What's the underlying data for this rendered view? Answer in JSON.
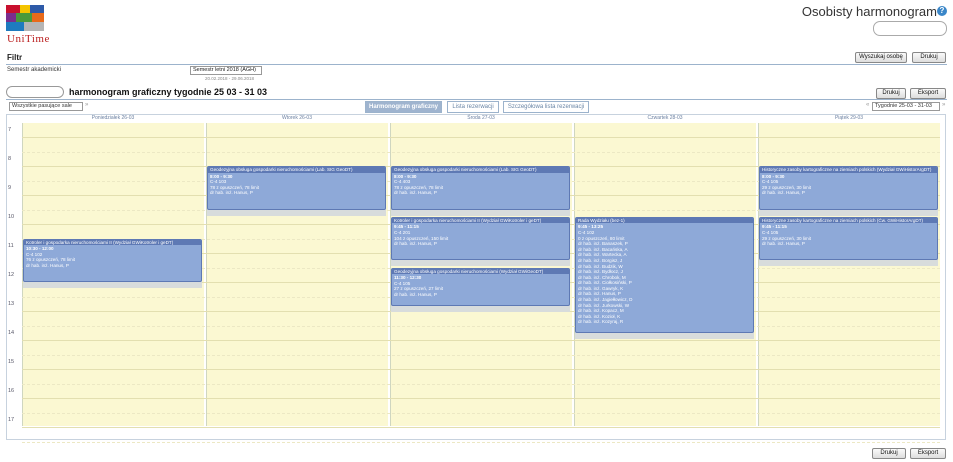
{
  "app": {
    "logo_text": "UniTime",
    "page_title": "Osobisty harmonogram",
    "help_icon": "help-icon"
  },
  "filter": {
    "label": "Filtr",
    "search_person_button": "Wyszukaj osobę",
    "print_button": "Drukuj",
    "term_label": "Semestr akademicki",
    "term_value": "Semestr letni 2018 (AGH)",
    "term_dates": "20.02.2018 - 29.06.2018"
  },
  "schedule": {
    "title": "harmonogram graficzny tygodnie 25 03 - 31 03",
    "print_button": "Drukuj",
    "export_button": "Eksport",
    "rooms_filter": "Wszystkie pasujące sale",
    "week_select": "Tygodnie 25-03 - 31-03",
    "tabs": [
      {
        "label": "Harmonogram graficzny",
        "active": true
      },
      {
        "label": "Lista rezerwacji",
        "active": false
      },
      {
        "label": "Szczegółowa lista rezerwacji",
        "active": false
      }
    ],
    "days": [
      "Poniedziałek 26-03",
      "Wtorek 26-03",
      "Środa 27-03",
      "Czwartek 28-03",
      "Piątek 29-03"
    ],
    "hours": [
      "7",
      "8",
      "9",
      "10",
      "11",
      "12",
      "13",
      "14",
      "15",
      "16",
      "17"
    ],
    "events": [
      {
        "day": 0,
        "title": "Kotroler i gospodarka nieruchomościami II (Wydział GWiKotroler i geDT)",
        "time": "10:30 - 12:00",
        "room": "C-4 102",
        "lines": [
          "76 z opuszczeń, 78 limit",
          "dr hab. inż. Hanus, P"
        ]
      },
      {
        "day": 1,
        "title": "Geodezyjna obsługa gospodarki nieruchomościami (Lab. SIG GeoDT)",
        "time": "8:00 - 9:30",
        "room": "C-4 103",
        "lines": [
          "78 z opuszczeń, 78 limit",
          "dr hab. inż. Hanus, P"
        ]
      },
      {
        "day": 2,
        "title": "Geodezyjna obsługa gospodarki nieruchomościami (Lab. SIG GeoDT)",
        "time": "8:00 - 9:30",
        "room": "C-4 403",
        "lines": [
          "78 z opuszczeń, 78 limit",
          "dr hab. inż. Hanus, P"
        ]
      },
      {
        "day": 2,
        "title": "Kotroler i gospodarka nieruchomościami II (Wydział GWiKotroler i geDT)",
        "time": "9:45 - 11:15",
        "room": "C-4 201",
        "lines": [
          "104 z opuszczeń, 150 limit",
          "dr hab. inż. Hanus, P"
        ]
      },
      {
        "day": 2,
        "title": "Geodezyjna obsługa gospodarki nieruchomościami (Wydział GWiGeoDT)",
        "time": "11:30 - 12:30",
        "room": "C-4 105",
        "lines": [
          "27 z opuszczeń, 27 limit",
          "dr hab. inż. Hanus, P"
        ]
      },
      {
        "day": 3,
        "title": "Rada Wydziału (bez-1)",
        "time": "9:45 - 13:25",
        "room": "C-4 102",
        "lines": [
          "0 z opuszczeń, 80 limit",
          "dr hab. inż. Banaszek, P",
          "dr hab. inż. Bacańska, A",
          "dr hab. inż. Wartecka, A",
          "dr hab. inż. Borgisz, J",
          "dr hab. inż. Budzik, W",
          "dr hab. inż. Bydłocz, J",
          "dr hab. inż. Chrobok, M",
          "dr hab. inż. Ciołkosiński, P",
          "dr hab. inż. Gawryk, K",
          "dr hab. inż. Hanus, P",
          "dr hab. inż. Jagiełłowicz, D",
          "dr hab. inż. Jurkowski, W",
          "dr hab. inż. Kopacz, M",
          "dr hab. inż. Kozioł, K",
          "dr hab. inż. Kozyraj, R"
        ]
      },
      {
        "day": 4,
        "title": "Historyczne zasoby kartograficzne na ziemiach polskich (Wydział GWiHistorArgDT)",
        "time": "8:00 - 9:30",
        "room": "C-4 105",
        "lines": [
          "29 z opuszczeń, 30 limit",
          "dr hab. inż. Hanus, P"
        ]
      },
      {
        "day": 4,
        "title": "Historyczne zasoby kartograficzne na ziemiach polskich (Ćw. GWiHistorArgDT)",
        "time": "9:45 - 11:15",
        "room": "C-4 105",
        "lines": [
          "29 z opuszczeń, 30 limit",
          "dr hab. inż. Hanus, P"
        ]
      }
    ]
  },
  "footer": {
    "print_button": "Drukuj",
    "export_button": "Eksport"
  },
  "colors": {
    "grid_yellow": "#fbf8d2",
    "event_blue": "#8ea9d8",
    "event_border": "#5e79b4",
    "tab_active": "#9fb4cf"
  }
}
